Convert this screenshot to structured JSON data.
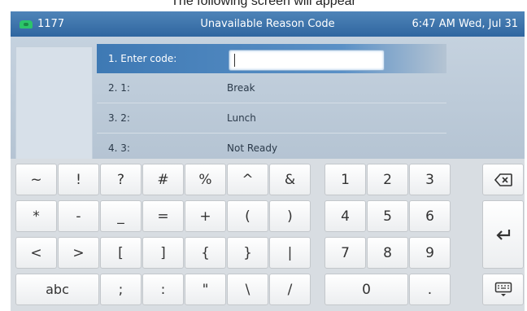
{
  "caption": "The following screen will appear",
  "topbar": {
    "extension": "1177",
    "title": "Unavailable Reason Code",
    "clock": "6:47 AM Wed, Jul 31",
    "icon": "phone-line-icon"
  },
  "rows": [
    {
      "num": "1. Enter code:",
      "value": ""
    },
    {
      "num": "2. 1:",
      "value": "Break"
    },
    {
      "num": "3. 2:",
      "value": "Lunch"
    },
    {
      "num": "4. 3:",
      "value": "Not Ready"
    }
  ],
  "keys": {
    "r1": [
      "~",
      "!",
      "?",
      "#",
      "%",
      "^",
      "&"
    ],
    "r2": [
      "*",
      "-",
      "_",
      "=",
      "+",
      "(",
      ")"
    ],
    "r3": [
      "<",
      ">",
      "[",
      "]",
      "{",
      "}",
      "|"
    ],
    "r4": [
      "abc",
      ";",
      ":",
      "\"",
      "\\",
      "/"
    ],
    "num1": [
      "1",
      "2",
      "3"
    ],
    "num2": [
      "4",
      "5",
      "6"
    ],
    "num3": [
      "7",
      "8",
      "9"
    ],
    "num4": [
      "0",
      "."
    ]
  },
  "icons": {
    "backspace": "backspace-icon",
    "enter": "enter-icon",
    "hide_keyboard": "keyboard-hide-icon"
  }
}
